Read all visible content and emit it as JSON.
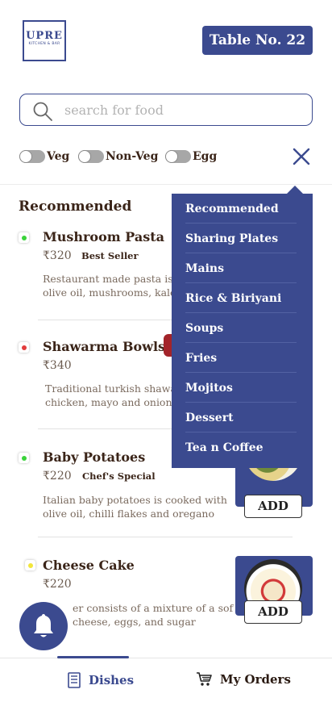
{
  "header": {
    "logo_main": "UPRE",
    "logo_sub": "KITCHEN & BAR",
    "table_label": "Table No. 22"
  },
  "search": {
    "placeholder": "search for food",
    "value": ""
  },
  "filters": [
    {
      "label": "Veg",
      "on": false
    },
    {
      "label": "Non-Veg",
      "on": false
    },
    {
      "label": "Egg",
      "on": false
    }
  ],
  "section_title": "Recommended",
  "items": [
    {
      "name": "Mushroom Pasta",
      "price": "₹320",
      "tag": "Best Seller",
      "desc_line1": "Restaurant made pasta is",
      "desc_line2": "olive oil, mushrooms, kale",
      "type_color": "#3ad23a"
    },
    {
      "name": "Shawarma Bowls",
      "price": "₹340",
      "tag": "",
      "desc_line1": "Traditional turkish shawa",
      "desc_line2": "chicken, mayo and onions",
      "type_color": "#e23b3b"
    },
    {
      "name": "Baby Potatoes",
      "price": "₹220",
      "tag": "Chef's Special",
      "desc_line1": "Italian baby potatoes is cooked with",
      "desc_line2": "olive oil, chilli flakes and oregano",
      "type_color": "#3ad23a",
      "add_label": "ADD"
    },
    {
      "name": "Cheese Cake",
      "price": "₹220",
      "tag": "",
      "desc_line1": "er consists of a mixture of a soft,",
      "desc_line2": "cheese, eggs, and sugar",
      "type_color": "#f2e63a",
      "add_label": "ADD"
    }
  ],
  "menu": {
    "categories": [
      "Recommended",
      "Sharing Plates",
      "Mains",
      "Rice & Biriyani",
      "Soups",
      "Fries",
      "Mojitos",
      "Dessert",
      "Tea n Coffee"
    ]
  },
  "bottom_nav": {
    "dishes_label": "Dishes",
    "orders_label": "My Orders"
  },
  "colors": {
    "accent": "#3b4a8f",
    "text": "#3a2418"
  },
  "icons": {
    "search": "search-icon",
    "close": "close-icon",
    "bell": "bell-icon",
    "dishes": "menu-book-icon",
    "orders": "cart-icon"
  }
}
